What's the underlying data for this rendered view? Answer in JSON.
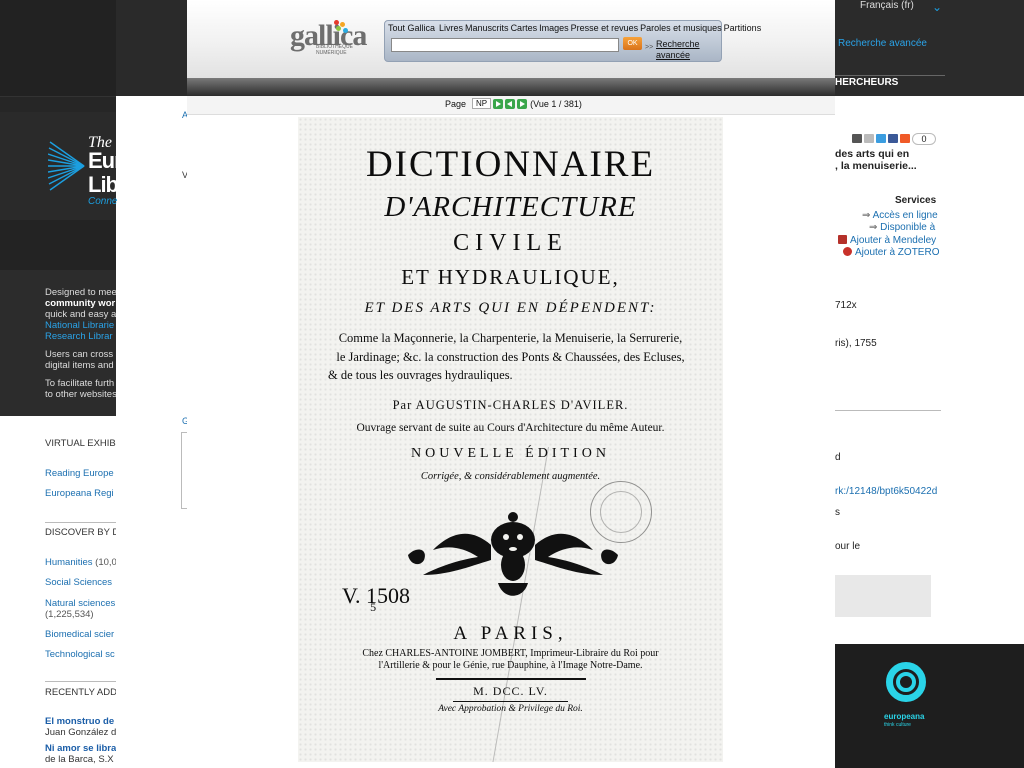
{
  "background": {
    "language_selector": "Français (fr)",
    "advanced_search": "Recherche avancée",
    "researchers_heading": "HERCHEURS",
    "logo": {
      "line1": "The",
      "line2": "Eur",
      "line3": "Lib",
      "tagline": "Conne"
    },
    "left_intro": [
      {
        "text": "Designed to mee",
        "style": "normal"
      },
      {
        "text": "community wor",
        "style": "bold"
      },
      {
        "text": "quick and easy a",
        "style": "normal"
      },
      {
        "text": "National Librarie",
        "style": "link"
      },
      {
        "text": "Research Librar",
        "style": "link"
      }
    ],
    "left_intro2": [
      "Users can cross",
      "digital items and"
    ],
    "left_intro3": [
      "To facilitate furth",
      "to other websites"
    ],
    "virtual_exhibitions": {
      "heading": "VIRTUAL EXHIB",
      "items": [
        "Reading Europe",
        "Europeana Regi"
      ]
    },
    "discover": {
      "heading": "DISCOVER BY D",
      "items": [
        {
          "label": "Humanities",
          "count": "(10,0"
        },
        {
          "label": "Social Sciences",
          "count": ""
        },
        {
          "label": "Natural sciences",
          "count": "(1,225,534)"
        },
        {
          "label": "Biomedical scier",
          "count": ""
        },
        {
          "label": "Technological sc",
          "count": ""
        }
      ]
    },
    "recently_added": {
      "heading": "RECENTLY ADD",
      "items": [
        {
          "title": "El monstruo de",
          "author": "Juan González d"
        },
        {
          "title": "Ni amor se libra",
          "author": "de la Barca, S.X"
        }
      ]
    },
    "record": {
      "title_line1": "des arts qui en",
      "title_line2": ", la menuiserie...",
      "share_count": "0",
      "services_heading": "Services",
      "services": [
        "Accès en ligne",
        "Disponible à",
        "Ajouter à Mendeley",
        "Ajouter à ZOTERO"
      ],
      "size": "712x",
      "imprint": "ris), 1755",
      "frag_d": "d",
      "ark": "rk:/12148/bpt6k50422d",
      "frag_s": "s",
      "frag_pour": "our le"
    },
    "middle_fragments": [
      "A",
      "V",
      "G"
    ],
    "europeana": {
      "name": "europeana",
      "sub": "think culture"
    }
  },
  "gallica": {
    "logo_word": "gallica",
    "logo_sub_line1": "BIBLIOTHÈQUE",
    "logo_sub_line2": "NUMÉRIQUE",
    "search_tabs": [
      "Tout Gallica",
      "Livres",
      "Manuscrits",
      "Cartes",
      "Images",
      "Presse et revues",
      "Paroles et musiques",
      "Partitions"
    ],
    "search_value": "",
    "ok_label": "OK",
    "arrow_label": ">>",
    "advanced_line1": "Recherche",
    "advanced_line2": "avancée",
    "page_label": "Page",
    "page_value": "NP",
    "view_counter": "(Vue 1 / 381)"
  },
  "scan": {
    "title1": "DICTIONNAIRE",
    "title2": "D'ARCHITECTURE",
    "title3": "CIVILE",
    "title4": "ET HYDRAULIQUE,",
    "title5": "ET DES ARTS QUI EN DÉPENDENT:",
    "para1": "Comme la Maçonnerie, la Charpenterie, la Menuiserie, la Serrurerie,",
    "para2": "le Jardinage; &c. la construction des Ponts & Chaussées, des Ecluses,",
    "para3": "& de tous les ouvrages hydrauliques.",
    "author": "Par AUGUSTIN-CHARLES D'AVILER.",
    "ouvrage": "Ouvrage servant de suite au Cours d'Architecture du même Auteur.",
    "edition": "NOUVELLE ÉDITION",
    "corrigee": "Corrigée, & considérablement augmentée.",
    "call_number": "V. 1508",
    "call_sub": "5",
    "city": "A PARIS,",
    "printer1": "Chez CHARLES-ANTOINE JOMBERT, Imprimeur-Libraire du Roi pour",
    "printer2": "l'Artillerie & pour le Génie, rue Dauphine, à l'Image Notre-Dame.",
    "date": "M. DCC. LV.",
    "approbation": "Avec Approbation & Privilege du Roi."
  }
}
